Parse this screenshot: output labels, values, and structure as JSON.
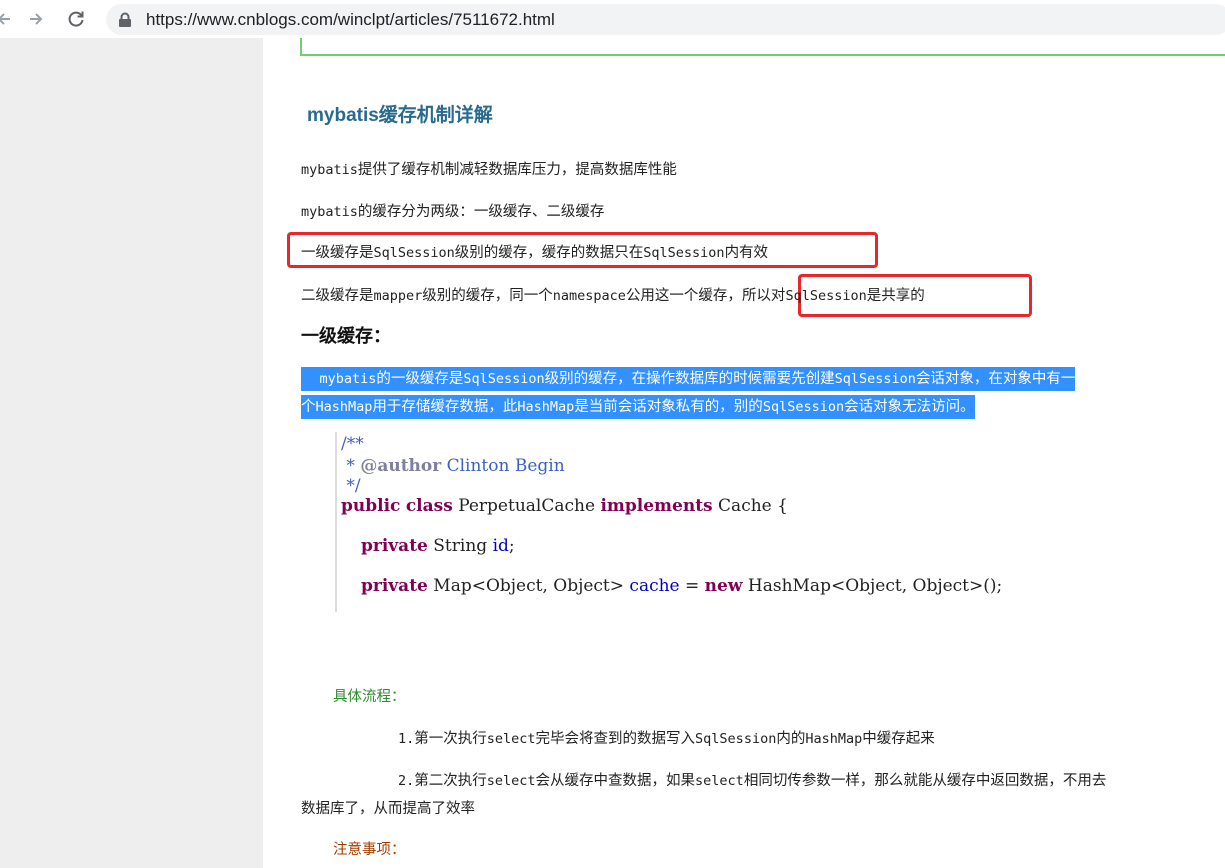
{
  "browser": {
    "url": "https://www.cnblogs.com/winclpt/articles/7511672.html"
  },
  "article": {
    "title": "mybatis缓存机制详解",
    "p1_a": "mybatis",
    "p1_b": "提供了缓存机制减轻数据库压力，提高数据库性能",
    "p2_a": "mybatis",
    "p2_b": "的缓存分为两级：一级缓存、二级缓存",
    "p3_a": "一级缓存是",
    "p3_b": "SqlSession",
    "p3_c": "级别的缓存，缓存的数据只在",
    "p3_d": "SqlSession",
    "p3_e": "内有效",
    "p4_a": "二级缓存是",
    "p4_b": "mapper",
    "p4_c": "级别的缓存，同一个",
    "p4_d": "namespace",
    "p4_e": "公用这一个缓存，",
    "p4_f": "所以对",
    "p4_g": "SqlSession",
    "p4_h": "是共享的",
    "heading_level1": "一级缓存：",
    "sel_1a": "mybatis",
    "sel_1b": "的一级缓存是",
    "sel_1c": "SqlSession",
    "sel_1d": "级别的缓存，在操作数据库的时候需要先创建",
    "sel_1e": "SqlSession",
    "sel_1f": "会话对象，在对象中有一",
    "sel_2a": "个",
    "sel_2b": "HashMap",
    "sel_2c": "用于存储缓存数据，此",
    "sel_2d": "HashMap",
    "sel_2e": "是当前会话对象私有的，别的",
    "sel_2f": "SqlSession",
    "sel_2g": "会话对象无法访问。",
    "code": {
      "l1": "/**",
      "l2_a": " * ",
      "l2_tag": "@author",
      "l2_b": " Clinton Begin",
      "l3": " */",
      "l4_kw1": "public",
      "l4_kw2": "class",
      "l4_name": "PerpetualCache",
      "l4_kw3": "implements",
      "l4_iface": "Cache {",
      "l5_kw": "private",
      "l5_type": "String",
      "l5_field": "id",
      "l5_end": ";",
      "l6_kw": "private",
      "l6_type": "Map<Object, Object>",
      "l6_field": "cache",
      "l6_eq": "=",
      "l6_new": "new",
      "l6_rest": "HashMap<Object, Object>();"
    },
    "flow_title": "具体流程：",
    "step1_a": "1.",
    "step1_b": "第一次执行",
    "step1_c": "select",
    "step1_d": "完毕会将查到的数据写入",
    "step1_e": "SqlSession",
    "step1_f": "内的",
    "step1_g": "HashMap",
    "step1_h": "中缓存起来",
    "step2_a": "2.",
    "step2_b": "第二次执行",
    "step2_c": "select",
    "step2_d": "会从缓存中查数据，如果",
    "step2_e": "select",
    "step2_f": "相同切传参数一样，那么就能从缓存中返回数据，不用去",
    "step2_g": "数据库了，从而提高了效率",
    "notes_title": "注意事项："
  }
}
